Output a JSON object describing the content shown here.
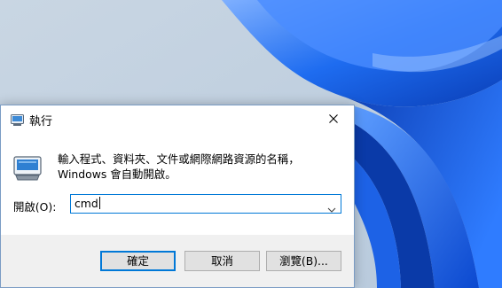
{
  "dialog": {
    "title": "執行",
    "description": "輸入程式、資料夾、文件或網際網路資源的名稱，Windows 會自動開啟。",
    "open_label": "開啟(O):",
    "command_value": "cmd",
    "buttons": {
      "ok": "確定",
      "cancel": "取消",
      "browse": "瀏覽(B)..."
    }
  },
  "icons": {
    "title": "run-icon",
    "body": "run-icon",
    "close": "close-icon",
    "dropdown": "chevron-down-icon"
  },
  "colors": {
    "accent": "#0078d7",
    "dialog_bg": "#f0f0f0",
    "button_bg": "#e1e1e1",
    "wallpaper_blue": "#1a5fe0"
  }
}
